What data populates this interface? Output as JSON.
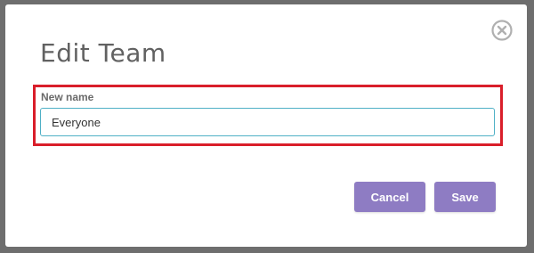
{
  "dialog": {
    "title": "Edit Team",
    "close_icon": "close-circle-icon",
    "field": {
      "label": "New name",
      "value": "Everyone"
    },
    "buttons": {
      "cancel_label": "Cancel",
      "save_label": "Save"
    }
  },
  "colors": {
    "accent": "#8e7cc3",
    "highlight": "#d91e2a",
    "input_border": "#4fb0c6",
    "backdrop": "#6e6e6e"
  }
}
